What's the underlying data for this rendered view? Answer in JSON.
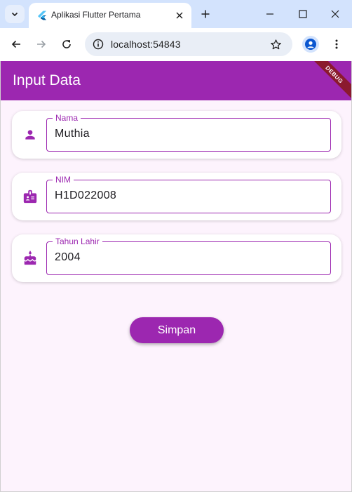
{
  "browser": {
    "tab_title": "Aplikasi Flutter Pertama",
    "url": "localhost:54843"
  },
  "app": {
    "title": "Input Data",
    "debug_banner": "DEBUG",
    "fields": [
      {
        "label": "Nama",
        "value": "Muthia",
        "icon": "person-icon"
      },
      {
        "label": "NIM",
        "value": "H1D022008",
        "icon": "badge-icon"
      },
      {
        "label": "Tahun Lahir",
        "value": "2004",
        "icon": "cake-icon"
      }
    ],
    "save_label": "Simpan"
  },
  "colors": {
    "primary": "#9c27b0",
    "background": "#fdf3fd",
    "chrome_tabstrip": "#d3e3fd"
  }
}
